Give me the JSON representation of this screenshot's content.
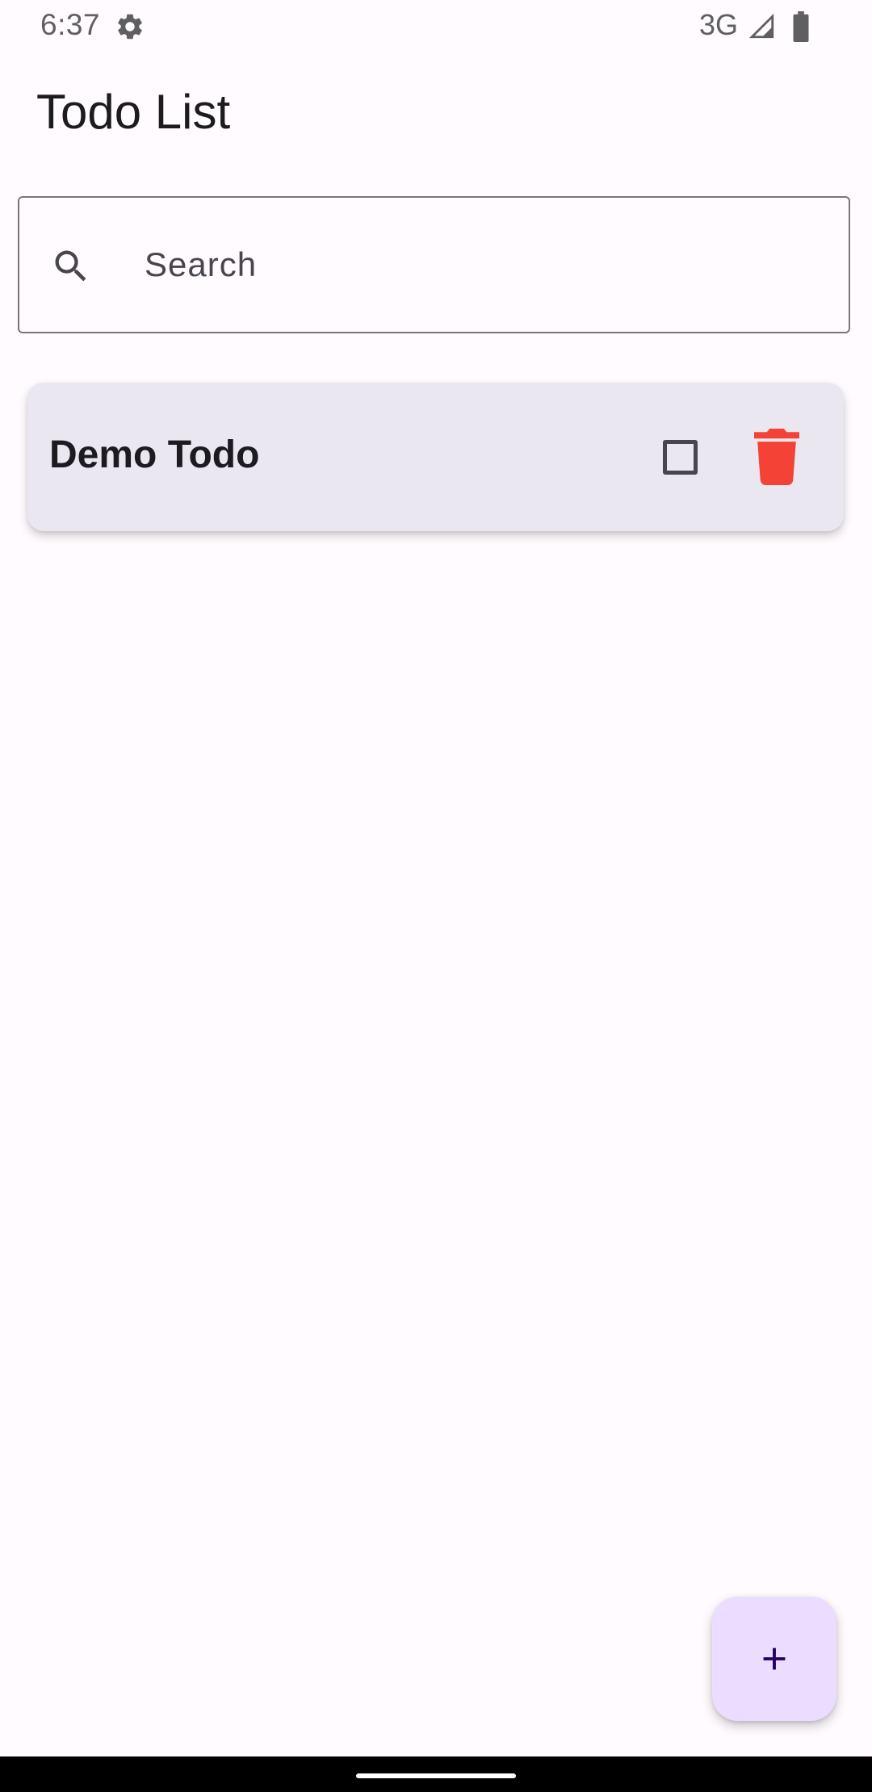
{
  "status_bar": {
    "time": "6:37",
    "network": "3G",
    "icons": [
      "gear-icon",
      "signal-icon",
      "battery-icon"
    ]
  },
  "app_bar": {
    "title": "Todo List"
  },
  "search": {
    "placeholder": "Search",
    "value": "",
    "icon": "search-icon"
  },
  "todos": [
    {
      "title": "Demo Todo",
      "completed": false,
      "checkbox_icon": "checkbox-unchecked-icon",
      "delete_icon": "trash-icon"
    }
  ],
  "fab": {
    "icon": "plus-icon"
  },
  "colors": {
    "background": "#fffbfe",
    "card": "#ebe7f1",
    "delete": "#f44336",
    "fab": "#eaddff",
    "fab_icon": "#21005d",
    "outline": "#79747e"
  }
}
